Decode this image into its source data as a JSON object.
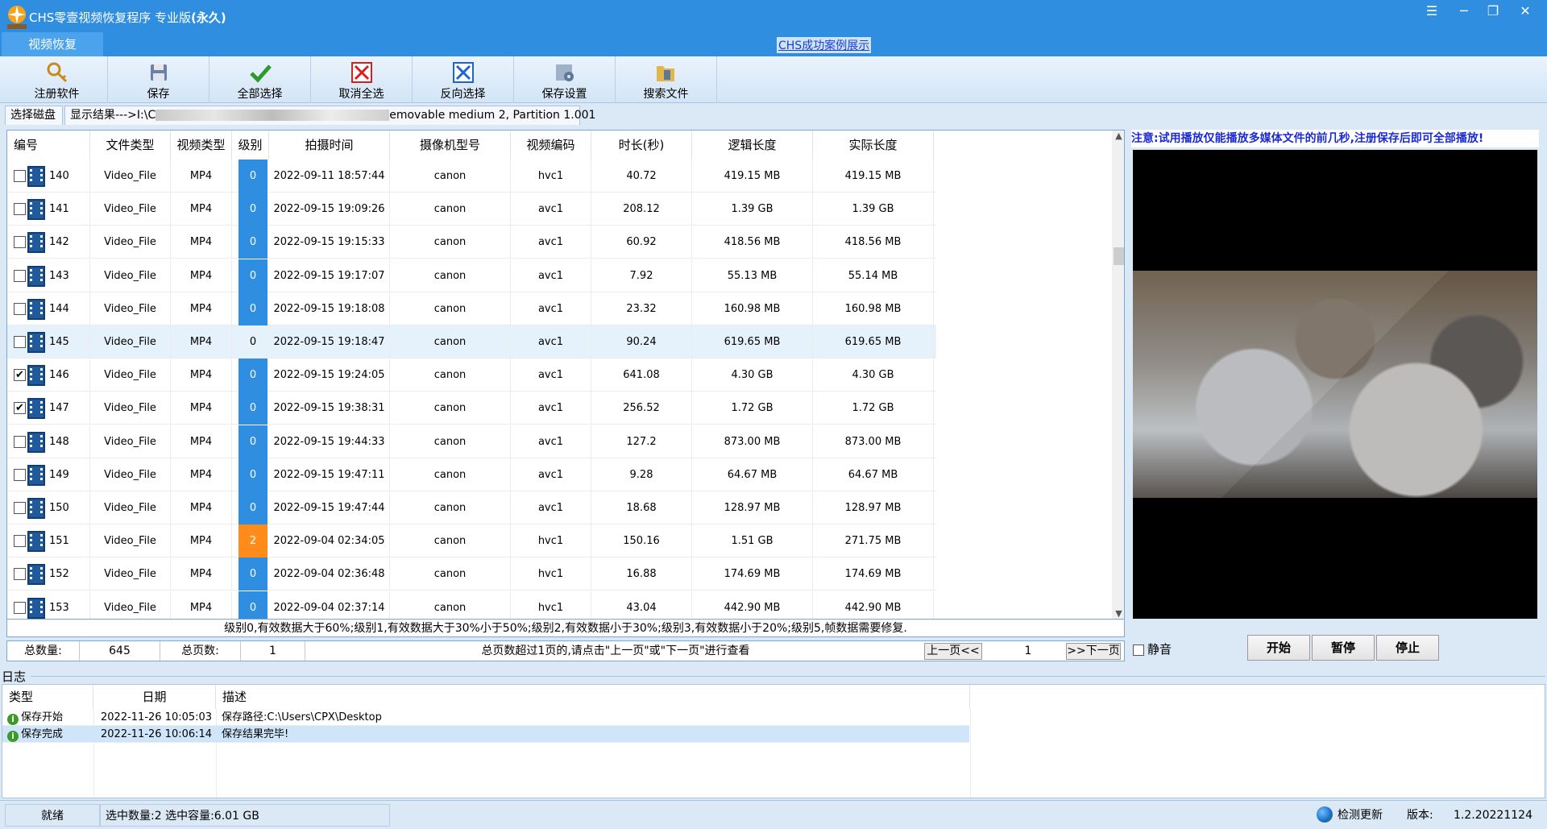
{
  "window": {
    "title_main": "CHS零壹视频恢复程序 专业版",
    "title_suffix": "(永久)",
    "controls": [
      "☰",
      "─",
      "❐",
      "✕"
    ]
  },
  "menu": {
    "tab_label": "视频恢复",
    "link_label": "CHS成功案例展示"
  },
  "toolbar": {
    "items": [
      {
        "label": "注册软件",
        "icon": "key-icon"
      },
      {
        "label": "保存",
        "icon": "disk-save-icon"
      },
      {
        "label": "全部选择",
        "icon": "checkmark-icon"
      },
      {
        "label": "取消全选",
        "icon": "red-x-icon"
      },
      {
        "label": "反向选择",
        "icon": "blue-x-icon"
      },
      {
        "label": "保存设置",
        "icon": "settings-icon"
      },
      {
        "label": "搜索文件",
        "icon": "search-folder-icon"
      }
    ]
  },
  "source_tabs": {
    "select_disk": "选择磁盘",
    "result_prefix": "显示结果--->I:\\C",
    "result_suffix": "emovable medium 2, Partition 1.001"
  },
  "table": {
    "columns": [
      "编号",
      "文件类型",
      "视频类型",
      "级别",
      "拍摄时间",
      "摄像机型号",
      "视频编码",
      "时长(秒)",
      "逻辑长度",
      "实际长度"
    ],
    "rows": [
      {
        "id": "140",
        "file_type": "Video_File",
        "video_type": "MP4",
        "level": "0",
        "level_style": "b",
        "time": "2022-09-11 18:57:44",
        "camera": "canon",
        "codec": "hvc1",
        "duration": "40.72",
        "logical": "419.15 MB",
        "actual": "419.15 MB",
        "checked": false,
        "selected": false
      },
      {
        "id": "141",
        "file_type": "Video_File",
        "video_type": "MP4",
        "level": "0",
        "level_style": "b",
        "time": "2022-09-15 19:09:26",
        "camera": "canon",
        "codec": "avc1",
        "duration": "208.12",
        "logical": "1.39 GB",
        "actual": "1.39 GB",
        "checked": false,
        "selected": false
      },
      {
        "id": "142",
        "file_type": "Video_File",
        "video_type": "MP4",
        "level": "0",
        "level_style": "b",
        "time": "2022-09-15 19:15:33",
        "camera": "canon",
        "codec": "avc1",
        "duration": "60.92",
        "logical": "418.56 MB",
        "actual": "418.56 MB",
        "checked": false,
        "selected": false
      },
      {
        "id": "143",
        "file_type": "Video_File",
        "video_type": "MP4",
        "level": "0",
        "level_style": "b",
        "time": "2022-09-15 19:17:07",
        "camera": "canon",
        "codec": "avc1",
        "duration": "7.92",
        "logical": "55.13 MB",
        "actual": "55.14 MB",
        "checked": false,
        "selected": false
      },
      {
        "id": "144",
        "file_type": "Video_File",
        "video_type": "MP4",
        "level": "0",
        "level_style": "b",
        "time": "2022-09-15 19:18:08",
        "camera": "canon",
        "codec": "avc1",
        "duration": "23.32",
        "logical": "160.98 MB",
        "actual": "160.98 MB",
        "checked": false,
        "selected": false
      },
      {
        "id": "145",
        "file_type": "Video_File",
        "video_type": "MP4",
        "level": "0",
        "level_style": "n",
        "time": "2022-09-15 19:18:47",
        "camera": "canon",
        "codec": "avc1",
        "duration": "90.24",
        "logical": "619.65 MB",
        "actual": "619.65 MB",
        "checked": false,
        "selected": true
      },
      {
        "id": "146",
        "file_type": "Video_File",
        "video_type": "MP4",
        "level": "0",
        "level_style": "b",
        "time": "2022-09-15 19:24:05",
        "camera": "canon",
        "codec": "avc1",
        "duration": "641.08",
        "logical": "4.30 GB",
        "actual": "4.30 GB",
        "checked": true,
        "selected": false
      },
      {
        "id": "147",
        "file_type": "Video_File",
        "video_type": "MP4",
        "level": "0",
        "level_style": "b",
        "time": "2022-09-15 19:38:31",
        "camera": "canon",
        "codec": "avc1",
        "duration": "256.52",
        "logical": "1.72 GB",
        "actual": "1.72 GB",
        "checked": true,
        "selected": false
      },
      {
        "id": "148",
        "file_type": "Video_File",
        "video_type": "MP4",
        "level": "0",
        "level_style": "b",
        "time": "2022-09-15 19:44:33",
        "camera": "canon",
        "codec": "avc1",
        "duration": "127.2",
        "logical": "873.00 MB",
        "actual": "873.00 MB",
        "checked": false,
        "selected": false
      },
      {
        "id": "149",
        "file_type": "Video_File",
        "video_type": "MP4",
        "level": "0",
        "level_style": "b",
        "time": "2022-09-15 19:47:11",
        "camera": "canon",
        "codec": "avc1",
        "duration": "9.28",
        "logical": "64.67 MB",
        "actual": "64.67 MB",
        "checked": false,
        "selected": false
      },
      {
        "id": "150",
        "file_type": "Video_File",
        "video_type": "MP4",
        "level": "0",
        "level_style": "b",
        "time": "2022-09-15 19:47:44",
        "camera": "canon",
        "codec": "avc1",
        "duration": "18.68",
        "logical": "128.97 MB",
        "actual": "128.97 MB",
        "checked": false,
        "selected": false
      },
      {
        "id": "151",
        "file_type": "Video_File",
        "video_type": "MP4",
        "level": "2",
        "level_style": "o",
        "time": "2022-09-04 02:34:05",
        "camera": "canon",
        "codec": "hvc1",
        "duration": "150.16",
        "logical": "1.51 GB",
        "actual": "271.75 MB",
        "checked": false,
        "selected": false
      },
      {
        "id": "152",
        "file_type": "Video_File",
        "video_type": "MP4",
        "level": "0",
        "level_style": "b",
        "time": "2022-09-04 02:36:48",
        "camera": "canon",
        "codec": "hvc1",
        "duration": "16.88",
        "logical": "174.69 MB",
        "actual": "174.69 MB",
        "checked": false,
        "selected": false
      },
      {
        "id": "153",
        "file_type": "Video_File",
        "video_type": "MP4",
        "level": "0",
        "level_style": "b",
        "time": "2022-09-04 02:37:14",
        "camera": "canon",
        "codec": "hvc1",
        "duration": "43.04",
        "logical": "442.90 MB",
        "actual": "442.90 MB",
        "checked": false,
        "selected": false
      }
    ]
  },
  "legend": "级别0,有效数据大于60%;级别1,有效数据大于30%小于50%;级别2,有效数据小于30%;级别3,有效数据小于20%;级别5,帧数据需要修复.",
  "footer": {
    "total_label": "总数量:",
    "total_value": "645",
    "pages_label": "总页数:",
    "pages_value": "1",
    "hint": "总页数超过1页的,请点击\"上一页\"或\"下一页\"进行查看",
    "prev_label": "上一页<<",
    "page_value": "1",
    "next_label": ">>下一页"
  },
  "preview": {
    "notice": "注意:试用播放仅能播放多媒体文件的前几秒,注册保存后即可全部播放!",
    "mute_label": "静音",
    "start_label": "开始",
    "pause_label": "暂停",
    "stop_label": "停止"
  },
  "log": {
    "label": "日志",
    "columns": [
      "类型",
      "日期",
      "描述"
    ],
    "rows": [
      {
        "type": "保存开始",
        "date": "2022-11-26 10:05:03",
        "desc": "保存路径:C:\\Users\\CPX\\Desktop",
        "selected": false
      },
      {
        "type": "保存完成",
        "date": "2022-11-26 10:06:14",
        "desc": "保存结果完毕!",
        "selected": true
      }
    ]
  },
  "status": {
    "ready": "就绪",
    "selection": "选中数量:2 选中容量:6.01 GB",
    "check_update": "检测更新",
    "version_label": "版本:",
    "version_value": "1.2.20221124"
  },
  "colors": {
    "title_bar": "#2f8ee0",
    "level_normal": "#2f8ee0",
    "level_warning": "#ff8c1a",
    "notice_text": "#1a2bd6"
  }
}
